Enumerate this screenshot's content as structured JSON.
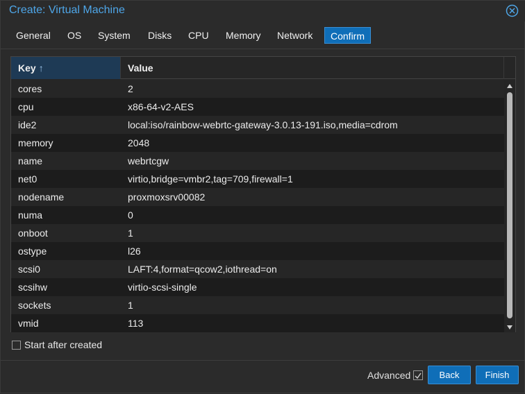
{
  "window": {
    "title": "Create: Virtual Machine"
  },
  "tabs": [
    {
      "label": "General"
    },
    {
      "label": "OS"
    },
    {
      "label": "System"
    },
    {
      "label": "Disks"
    },
    {
      "label": "CPU"
    },
    {
      "label": "Memory"
    },
    {
      "label": "Network"
    },
    {
      "label": "Confirm",
      "active": true
    }
  ],
  "grid": {
    "columns": {
      "key": "Key",
      "key_sort": "↑",
      "value": "Value"
    },
    "rows": [
      {
        "key": "cores",
        "value": "2"
      },
      {
        "key": "cpu",
        "value": "x86-64-v2-AES"
      },
      {
        "key": "ide2",
        "value": "local:iso/rainbow-webrtc-gateway-3.0.13-191.iso,media=cdrom"
      },
      {
        "key": "memory",
        "value": "2048"
      },
      {
        "key": "name",
        "value": "webrtcgw"
      },
      {
        "key": "net0",
        "value": "virtio,bridge=vmbr2,tag=709,firewall=1"
      },
      {
        "key": "nodename",
        "value": "proxmoxsrv00082"
      },
      {
        "key": "numa",
        "value": "0"
      },
      {
        "key": "onboot",
        "value": "1"
      },
      {
        "key": "ostype",
        "value": "l26"
      },
      {
        "key": "scsi0",
        "value": "LAFT:4,format=qcow2,iothread=on"
      },
      {
        "key": "scsihw",
        "value": "virtio-scsi-single"
      },
      {
        "key": "sockets",
        "value": "1"
      },
      {
        "key": "vmid",
        "value": "113"
      }
    ]
  },
  "options": {
    "start_after_created": "Start after created",
    "start_after_created_checked": false
  },
  "footer": {
    "advanced_label": "Advanced",
    "advanced_checked": true,
    "back_label": "Back",
    "finish_label": "Finish"
  },
  "colors": {
    "accent": "#0f6eb8",
    "title": "#4ea6e8",
    "background": "#2b2b2b"
  },
  "icons": {
    "close": "close-circle-icon",
    "sort": "sort-ascending-icon"
  }
}
